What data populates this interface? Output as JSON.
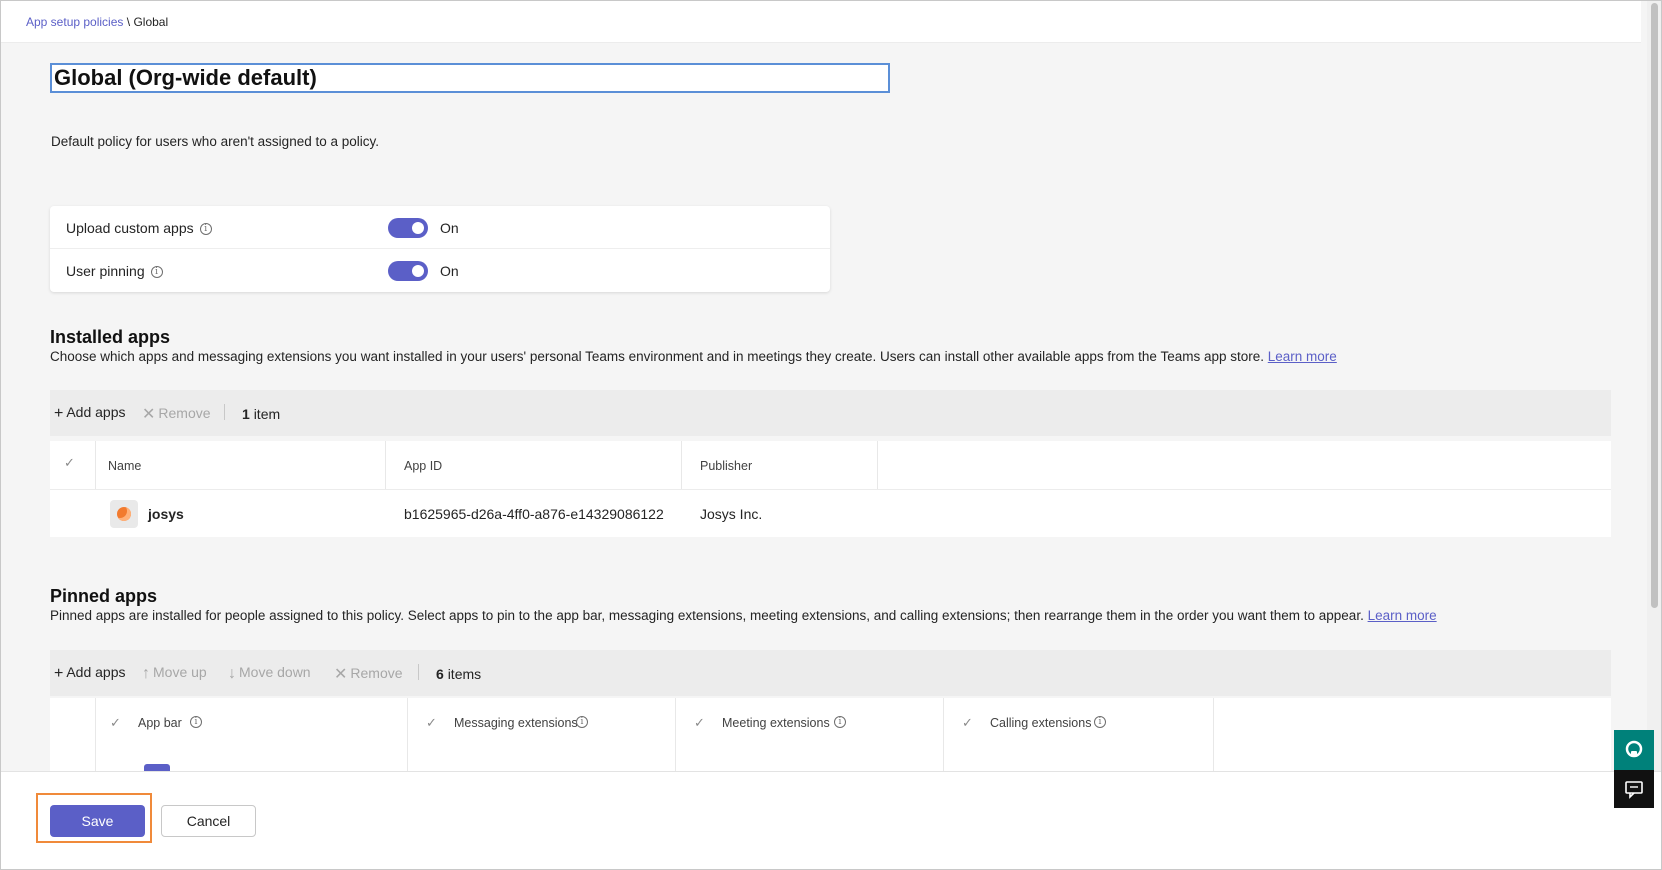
{
  "breadcrumb": {
    "parent": "App setup policies",
    "separator": "\\",
    "current": "Global"
  },
  "policy": {
    "name": "Global (Org-wide default)",
    "description": "Default policy for users who aren't assigned to a policy."
  },
  "settings": [
    {
      "label": "Upload custom apps",
      "state": "On"
    },
    {
      "label": "User pinning",
      "state": "On"
    }
  ],
  "installed_apps": {
    "title": "Installed apps",
    "description": "Choose which apps and messaging extensions you want installed in your users' personal Teams environment and in meetings they create. Users can install other available apps from the Teams app store.",
    "learn_more": "Learn more",
    "toolbar": {
      "add": "Add apps",
      "remove": "Remove",
      "count_num": "1",
      "count_label": "item"
    },
    "columns": [
      "Name",
      "App ID",
      "Publisher"
    ],
    "rows": [
      {
        "name": "josys",
        "app_id": "b1625965-d26a-4ff0-a876-e14329086122",
        "publisher": "Josys Inc."
      }
    ]
  },
  "pinned_apps": {
    "title": "Pinned apps",
    "description": "Pinned apps are installed for people assigned to this policy. Select apps to pin to the app bar, messaging extensions, meeting extensions, and calling extensions; then rearrange them in the order you want them to appear.",
    "learn_more": "Learn more",
    "toolbar": {
      "add": "Add apps",
      "move_up": "Move up",
      "move_down": "Move down",
      "remove": "Remove",
      "count_num": "6",
      "count_label": "items"
    },
    "columns": [
      "App bar",
      "Messaging extensions",
      "Meeting extensions",
      "Calling extensions"
    ]
  },
  "footer": {
    "save": "Save",
    "cancel": "Cancel"
  },
  "colors": {
    "accent": "#5b5fc7",
    "highlight": "#f08a3a",
    "help": "#00817a"
  },
  "icons": {
    "info": "info-icon",
    "add": "plus-icon",
    "remove": "close-icon",
    "up": "arrow-up-icon",
    "down": "arrow-down-icon",
    "check": "checkmark-icon"
  }
}
